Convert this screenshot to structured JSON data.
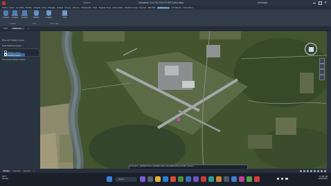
{
  "window": {
    "title": "Autodesk Civil 3D 2024   PUDS Ortho.dwg",
    "search_hint": "Search",
    "user": "wmclegh"
  },
  "menu": [
    "Home",
    "Insert",
    "Annotate",
    "Modify",
    "Analyze",
    "View",
    "Manage",
    "Output",
    "Survey",
    "Add-ins",
    "Collaborate",
    "Help",
    "Express Tools",
    "Geolocation",
    "Featured Apps",
    "Express",
    "BIM 360",
    "Performance",
    "InfraWorks",
    "Geolocation"
  ],
  "menu_active_index": 17,
  "ribbon": {
    "buttons": [
      {
        "label": "Edit Location",
        "icon": "globe-icon"
      },
      {
        "label": "Reorient Location",
        "icon": "globe-icon"
      },
      {
        "label": "Remove Location",
        "icon": "globe-icon"
      },
      {
        "label": "Mark Position",
        "icon": "pin-icon"
      },
      {
        "label": "Set Imagery",
        "icon": "image-icon"
      },
      {
        "label": "Capture Area",
        "icon": "capture-icon"
      }
    ],
    "groups": [
      "Location",
      "Tools",
      "Online Map"
    ]
  },
  "doc_tabs": [
    "Start",
    "PUDS Ort..."
  ],
  "left_panel": {
    "rows": [
      "Map and Imagery Layers",
      "Data Features Layers",
      "Imagery Layers",
      "Drawing Layers",
      "Document Feature Layers"
    ]
  },
  "command_line": "Command: _GEOMAP  Enter GEOMAP option [Aerial/Road/Hybrid/Off] <Aerial>:",
  "layout_tabs": [
    "Model",
    "Layout1",
    "Layout2"
  ],
  "taskbar": {
    "weather_temp": "55°F",
    "weather_desc": "Cloudy",
    "search_label": "Search",
    "time": "11:28 AM",
    "date": "4/25/2024"
  },
  "colors": {
    "accent": "#3a6ea5",
    "map_grass": "#3f5230",
    "runway": "#9aa0a2"
  }
}
